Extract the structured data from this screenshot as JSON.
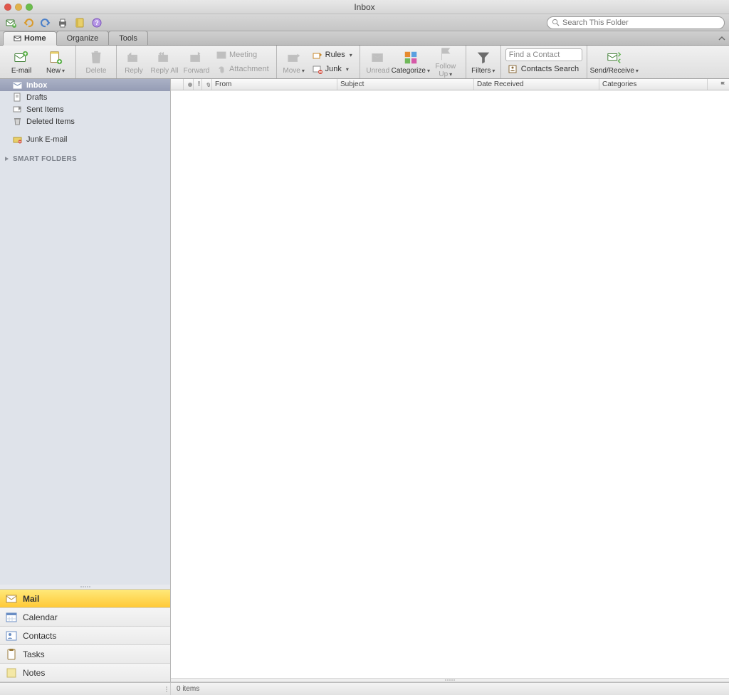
{
  "window": {
    "title": "Inbox"
  },
  "search": {
    "placeholder": "Search This Folder"
  },
  "tabs": {
    "home": "Home",
    "organize": "Organize",
    "tools": "Tools"
  },
  "ribbon": {
    "email": "E-mail",
    "new": "New",
    "delete": "Delete",
    "reply": "Reply",
    "reply_all": "Reply All",
    "forward": "Forward",
    "meeting": "Meeting",
    "attachment": "Attachment",
    "move": "Move",
    "rules": "Rules",
    "junk": "Junk",
    "unread": "Unread",
    "categorize": "Categorize",
    "follow_up": "Follow Up",
    "filters": "Filters",
    "find_contact_placeholder": "Find a Contact",
    "contacts_search": "Contacts Search",
    "send_receive": "Send/Receive"
  },
  "folders": {
    "inbox": "Inbox",
    "drafts": "Drafts",
    "sent": "Sent Items",
    "deleted": "Deleted Items",
    "junk": "Junk E-mail",
    "smart": "SMART FOLDERS"
  },
  "nav": {
    "mail": "Mail",
    "calendar": "Calendar",
    "contacts": "Contacts",
    "tasks": "Tasks",
    "notes": "Notes"
  },
  "columns": {
    "from": "From",
    "subject": "Subject",
    "date": "Date Received",
    "categories": "Categories"
  },
  "status": {
    "count": "0 items"
  }
}
